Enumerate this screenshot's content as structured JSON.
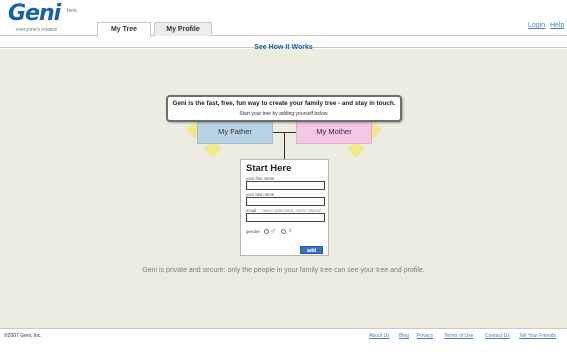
{
  "header": {
    "logo_text": "Geni",
    "logo_beta": "beta",
    "logo_tagline": "everyone's related",
    "tabs": [
      {
        "label": "My Tree",
        "active": true
      },
      {
        "label": "My Profile",
        "active": false
      }
    ],
    "links": {
      "login": "Login",
      "help": "Help"
    }
  },
  "subbar": {
    "see_how": "See How It Works"
  },
  "main": {
    "intro": {
      "line1": "Geni is the fast, free, fun way to create your family tree - and stay in touch.",
      "line2": "Start your tree by adding yourself below."
    },
    "father_label": "My Father",
    "mother_label": "My Mother",
    "form": {
      "title": "Start Here",
      "first_name_label": "your first name",
      "last_name_label": "your last name",
      "email_label": "email",
      "email_hint": "never spammed, never shared",
      "gender_label": "gender",
      "male_symbol": "♂",
      "female_symbol": "♀",
      "add_button": "add"
    },
    "secure_text": "Geni is private and secure: only the people in your family tree can see your tree and profile."
  },
  "footer": {
    "copyright": "©2007 Geni, Inc.",
    "links": [
      "About Us",
      "Blog",
      "Privacy",
      "Terms of Use",
      "Contact Us",
      "Tell Your Friends"
    ]
  },
  "colors": {
    "brand_blue": "#1b5fa8",
    "background": "#ecece0",
    "father_box": "#b9d3e6",
    "mother_box": "#f4c6e4",
    "arrow_yellow": "#f2e78a",
    "add_button": "#3c6fbf"
  }
}
